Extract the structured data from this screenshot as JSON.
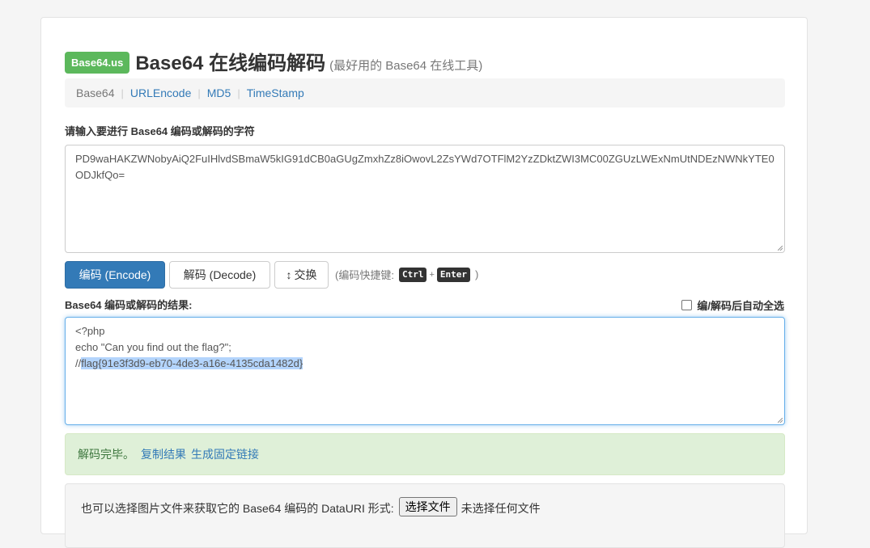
{
  "header": {
    "badge": "Base64.us",
    "title": "Base64 在线编码解码",
    "subtitle": "(最好用的 Base64 在线工具)"
  },
  "nav": {
    "items": [
      {
        "label": "Base64",
        "active": true
      },
      {
        "label": "URLEncode",
        "active": false
      },
      {
        "label": "MD5",
        "active": false
      },
      {
        "label": "TimeStamp",
        "active": false
      }
    ],
    "separator": "|"
  },
  "input": {
    "label": "请输入要进行 Base64 编码或解码的字符",
    "value": "PD9waHAKZWNobyAiQ2FuIHlvdSBmaW5kIG91dCB0aGUgZmxhZz8iOwovL2ZsYWd7OTFlM2YzZDktZWI3MC00ZGUzLWExNmUtNDEzNWNkYTE0ODJkfQo="
  },
  "buttons": {
    "encode": "编码 (Encode)",
    "decode": "解码 (Decode)",
    "swap_icon": "↕",
    "swap": "交换"
  },
  "shortcut": {
    "prefix": "(编码快捷键:",
    "key1": "Ctrl",
    "plus": "+",
    "key2": "Enter",
    "suffix": ")"
  },
  "output": {
    "label": "Base64 编码或解码的结果:",
    "auto_select_label": "编/解码后自动全选",
    "line1": "<?php",
    "line2": "echo \"Can you find out the flag?\";",
    "line3_prefix": "//",
    "line3_selected": "flag{91e3f3d9-eb70-4de3-a16e-4135cda1482d}"
  },
  "alert": {
    "message": "解码完毕。",
    "copy_link": "复制结果",
    "permalink": "生成固定链接"
  },
  "file": {
    "prompt": "也可以选择图片文件来获取它的 Base64 编码的 DataURI 形式:",
    "button": "选择文件",
    "status": "未选择任何文件"
  },
  "colors": {
    "primary": "#337ab7",
    "success_badge": "#5cb85c",
    "alert_bg": "#dff0d8",
    "alert_text": "#3c763d",
    "focus_border": "#66afe9"
  }
}
